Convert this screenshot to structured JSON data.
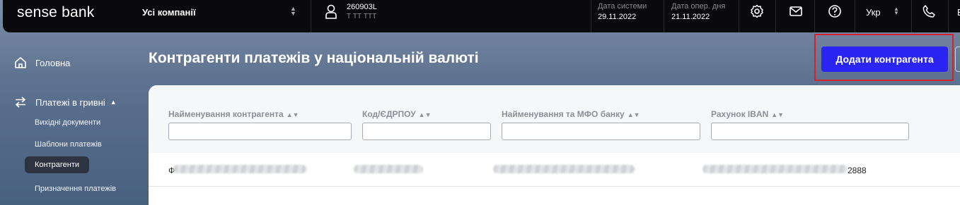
{
  "topbar": {
    "logo": "sense bank",
    "company_selector": "Усі компанії",
    "user_id": "260903L",
    "user_name": "Т ТТ ТТТ",
    "system_date_label": "Дата системи",
    "system_date": "29.11.2022",
    "oper_date_label": "Дата опер. дня",
    "oper_date": "21.11.2022",
    "language": "Укр",
    "truncated_item": "Е"
  },
  "sidebar": {
    "home": "Головна",
    "payments_uah": "Платежі в гривні",
    "sub_items": [
      "Вихідні документи",
      "Шаблони платежів",
      "Контрагенти",
      "Призначення платежів"
    ]
  },
  "main": {
    "title": "Контрагенти платежів у національній валюті",
    "add_button": "Додати контрагента",
    "columns": [
      "Найменування контрагента",
      "Код/ЄДРПОУ",
      "Найменування та МФО банку",
      "Рахунок IBAN"
    ],
    "row": {
      "name_prefix": "Ф",
      "iban_suffix": "2888"
    }
  },
  "colors": {
    "accent_button": "#2b25f4",
    "highlight_border": "#d6202a",
    "topbar_bg": "#0a0a0c"
  }
}
